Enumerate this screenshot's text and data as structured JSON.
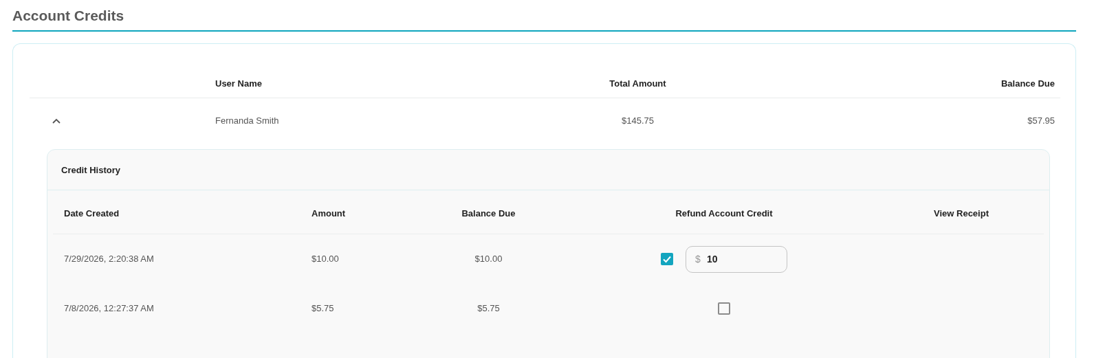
{
  "page_title": "Account Credits",
  "accounts_table": {
    "columns": [
      "User Name",
      "Total Amount",
      "Balance Due"
    ],
    "rows": [
      {
        "expanded": true,
        "user_name": "Fernanda Smith",
        "total_amount": "$145.75",
        "balance_due": "$57.95",
        "credit_history": {
          "title": "Credit History",
          "columns": [
            "Date Created",
            "Amount",
            "Balance Due",
            "Refund Account Credit",
            "View Receipt"
          ],
          "rows": [
            {
              "date_created": "7/29/2026, 2:20:38 AM",
              "amount": "$10.00",
              "balance_due": "$10.00",
              "refund_checked": true,
              "refund_prefix": "$",
              "refund_amount": "10"
            },
            {
              "date_created": "7/8/2026, 12:27:37 AM",
              "amount": "$5.75",
              "balance_due": "$5.75",
              "refund_checked": false
            }
          ]
        }
      }
    ]
  }
}
